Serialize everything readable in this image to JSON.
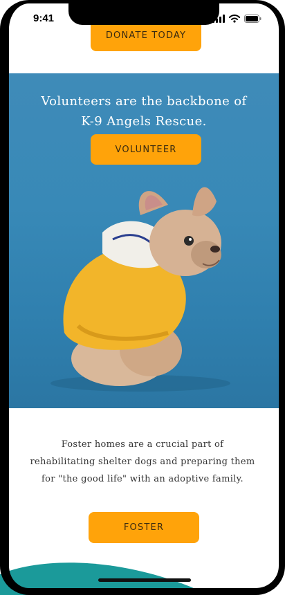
{
  "status_bar": {
    "time": "9:41"
  },
  "donate": {
    "label": "Donate today"
  },
  "volunteer": {
    "heading_line1": "Volunteers are the backbone of",
    "heading_line2": "K-9 Angels Rescue.",
    "button_label": "Volunteer"
  },
  "foster": {
    "text": "Foster homes are a crucial part of rehabilitating shelter dogs and preparing them for \"the good life\" with an adoptive family.",
    "button_label": "Foster"
  },
  "colors": {
    "accent": "#FFA30A",
    "panel_blue": "#3889b7",
    "teal": "#1b9a9a"
  },
  "icons": [
    "cellular-signal-icon",
    "wifi-icon",
    "battery-icon"
  ]
}
